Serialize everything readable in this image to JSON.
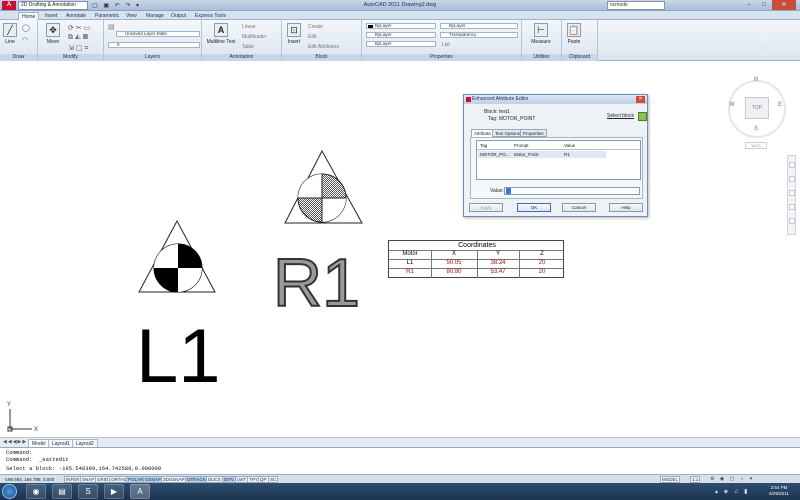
{
  "titlebar": {
    "workspace": "2D Drafting & Annotation",
    "title": "AutoCAD 2011   Drawing2.dwg",
    "search_value": "ocmode"
  },
  "ribbon_tabs": [
    "Home",
    "Insert",
    "Annotate",
    "Parametric",
    "View",
    "Manage",
    "Output",
    "Express Tools"
  ],
  "ribbon": {
    "draw": {
      "title": "Draw",
      "line": "Line"
    },
    "modify": {
      "title": "Modify",
      "move": "Move"
    },
    "layers": {
      "title": "Layers",
      "layer_state": "Unsaved Layer State",
      "layer_current": "0"
    },
    "annotation": {
      "title": "Annotation",
      "mtext": "Multiline Text",
      "linear": "Linear",
      "multileader": "Multileader",
      "table": "Table"
    },
    "block": {
      "title": "Block",
      "insert": "Insert",
      "create": "Create",
      "edit": "Edit",
      "edit_attributes": "Edit Attributes"
    },
    "properties": {
      "title": "Properties",
      "color": "ByLayer",
      "linetype": "ByLayer",
      "lineweight": "ByLayer",
      "layer1": "ByLayer",
      "transparency": "Transparency",
      "list": "List"
    },
    "utilities": {
      "title": "Utilities",
      "measure": "Measure"
    },
    "clipboard": {
      "title": "Clipboard",
      "paste": "Paste"
    }
  },
  "viewcube": {
    "top": "TOP",
    "n": "N",
    "s": "S",
    "e": "E",
    "w": "W",
    "wcs": "WCS"
  },
  "dialog": {
    "title": "Enhanced Attribute Editor",
    "block_label": "Block: test1",
    "tag_label": "Tag:  MOTOR_POINT",
    "select_block": "Select block",
    "tabs": [
      "Attribute",
      "Text Options",
      "Properties"
    ],
    "grid": {
      "headers": [
        "Tag",
        "Prompt",
        "Value"
      ],
      "rows": [
        {
          "tag": "MOTOR_PO...",
          "prompt": "Motor_Point",
          "value": "R1"
        }
      ]
    },
    "value_label": "Value:",
    "buttons": {
      "apply": "Apply",
      "ok": "OK",
      "cancel": "Cancel",
      "help": "Help"
    }
  },
  "coord_table": {
    "title": "Coordinates",
    "headers": [
      "Motor",
      "X",
      "Y",
      "Z"
    ],
    "rows": [
      {
        "motor": "L1",
        "x": "50.05",
        "y": "38.24",
        "z": "20"
      },
      {
        "motor": "R1",
        "x": "80.80",
        "y": "53.47",
        "z": "20"
      }
    ]
  },
  "labels": {
    "r1": "R1",
    "l1": "L1"
  },
  "ucs": {
    "y": "Y",
    "x": "X"
  },
  "layout_tabs": [
    "Model",
    "Layout1",
    "Layout2"
  ],
  "command": {
    "line1": "Command:",
    "line2": "Command:  _eattedit",
    "line3": "Select a block: -195.548399,164.742589,0.000000"
  },
  "statusbar": {
    "coords": "-195.594, 166.788, 0.000",
    "toggles": [
      "INFER",
      "SNAP",
      "GRID",
      "ORTHO",
      "POLAR",
      "OSNAP",
      "3DOSNAP",
      "OTRACK",
      "DUCS",
      "DYN",
      "LWT",
      "TPY",
      "QP",
      "SC"
    ],
    "model": "MODEL",
    "scale": "1:1"
  },
  "taskbar": {
    "time": "2:54 PM",
    "date": "6/29/2011"
  }
}
